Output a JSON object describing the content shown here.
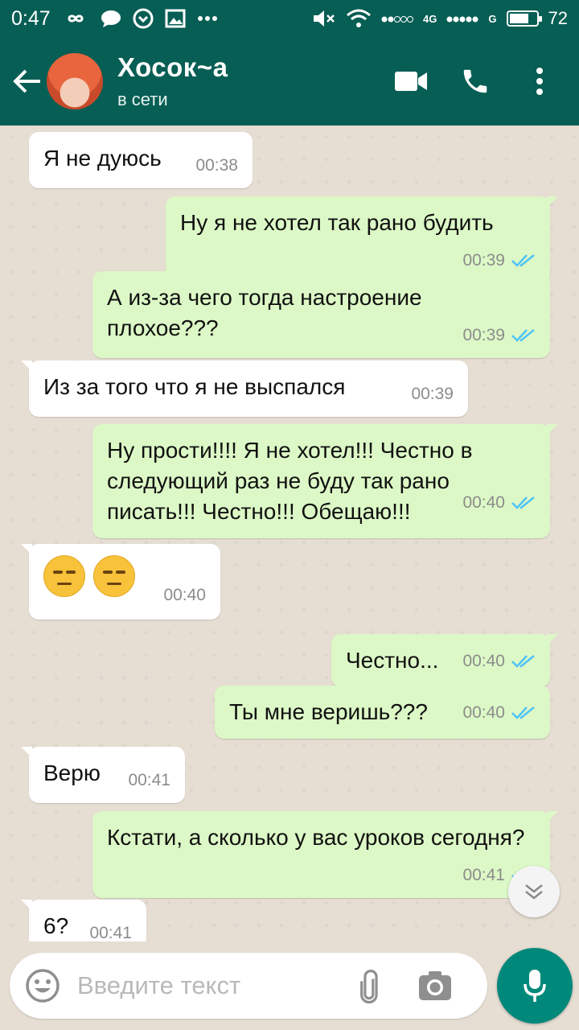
{
  "status_bar": {
    "time": "0:47",
    "left_icons": [
      "infinity-icon",
      "chat-bubble-icon",
      "download-icon",
      "image-icon",
      "more-dots-icon"
    ],
    "signal_1_label": "4G",
    "signal_2_label": "G",
    "battery_level": "72",
    "battery_fraction": 0.72
  },
  "header": {
    "contact_name": "Хосок~а",
    "contact_status": "в сети",
    "icons": [
      "back-arrow-icon",
      "video-call-icon",
      "phone-icon",
      "more-vert-icon"
    ],
    "bar_color": "#075e54"
  },
  "messages": [
    {
      "direction": "in",
      "text": "Я не дуюсь",
      "time": "00:38"
    },
    {
      "direction": "out",
      "text": "Ну я не хотел так рано будить",
      "time": "00:39",
      "read": true
    },
    {
      "direction": "out",
      "text": "А из-за чего тогда настроение плохое???",
      "time": "00:39",
      "read": true
    },
    {
      "direction": "in",
      "text": "Из за того что я не выспался",
      "time": "00:39"
    },
    {
      "direction": "out",
      "text": "Ну прости!!!! Я не хотел!!! Честно в следующий раз не буду так рано писать!!! Честно!!! Обещаю!!!",
      "time": "00:40",
      "read": true
    },
    {
      "direction": "in",
      "text": "😑😑",
      "time": "00:40",
      "emoji": [
        "expressionless-face-icon",
        "expressionless-face-icon"
      ]
    },
    {
      "direction": "out",
      "text": "Честно...",
      "time": "00:40",
      "read": true
    },
    {
      "direction": "out",
      "text": "Ты мне веришь???",
      "time": "00:40",
      "read": true
    },
    {
      "direction": "in",
      "text": "Верю",
      "time": "00:41"
    },
    {
      "direction": "out",
      "text": "Кстати, а сколько у вас уроков сегодня?",
      "time": "00:41",
      "read": true
    },
    {
      "direction": "in",
      "text": "6?",
      "time": "00:41"
    }
  ],
  "composer": {
    "placeholder": "Введите текст",
    "icons": [
      "emoji-icon",
      "attach-icon",
      "camera-icon",
      "mic-icon"
    ]
  },
  "colors": {
    "incoming_bubble": "#ffffff",
    "outgoing_bubble": "#dcf8c6",
    "read_ticks": "#4fc3f7",
    "accent": "#00897b"
  }
}
